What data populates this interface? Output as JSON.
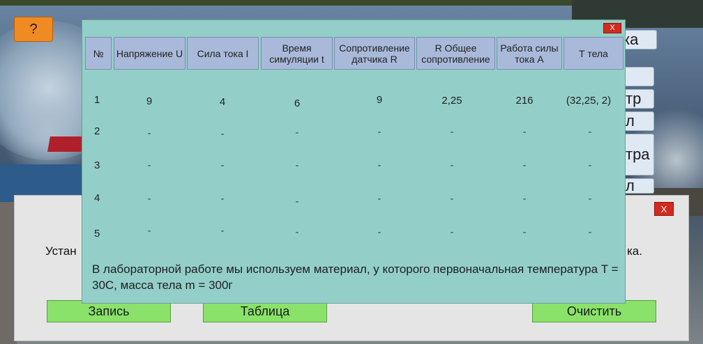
{
  "help_button": {
    "label": "?"
  },
  "side_buttons": [
    {
      "label": "ка"
    },
    {
      "label": ""
    },
    {
      "label": "тр"
    },
    {
      "label": "л"
    },
    {
      "label": "тра"
    },
    {
      "label": "л"
    }
  ],
  "back_dialog": {
    "text_left": "Устан",
    "text_right": "ка.",
    "close_label": "X",
    "buttons": {
      "record": "Запись",
      "table": "Таблица",
      "clear": "Очистить"
    }
  },
  "table_panel": {
    "close_label": "X",
    "headers": [
      "№",
      "Напряжение U",
      "Сила тока I",
      "Время симуляции t",
      "Сопротивление датчика R",
      "R Общее сопротивление",
      "Работа силы тока A",
      "T тела"
    ],
    "rows": [
      {
        "num": "1",
        "values": [
          "9",
          "4",
          "6",
          "9",
          "2,25",
          "216",
          "(32,25, 2)"
        ]
      },
      {
        "num": "2",
        "values": [
          "-",
          "-",
          "-",
          "-",
          "-",
          "-",
          "-"
        ]
      },
      {
        "num": "3",
        "values": [
          "-",
          "-",
          "-",
          "-",
          "-",
          "-",
          "-"
        ]
      },
      {
        "num": "4",
        "values": [
          "-",
          "-",
          "-",
          "-",
          "-",
          "-",
          "-"
        ]
      },
      {
        "num": "5",
        "values": [
          "-",
          "-",
          "-",
          "-",
          "-",
          "-",
          "-"
        ]
      }
    ],
    "note": "В лабораторной работе мы используем материал, у которого первоначальная температура T = 30С, масса тела m = 300г"
  }
}
